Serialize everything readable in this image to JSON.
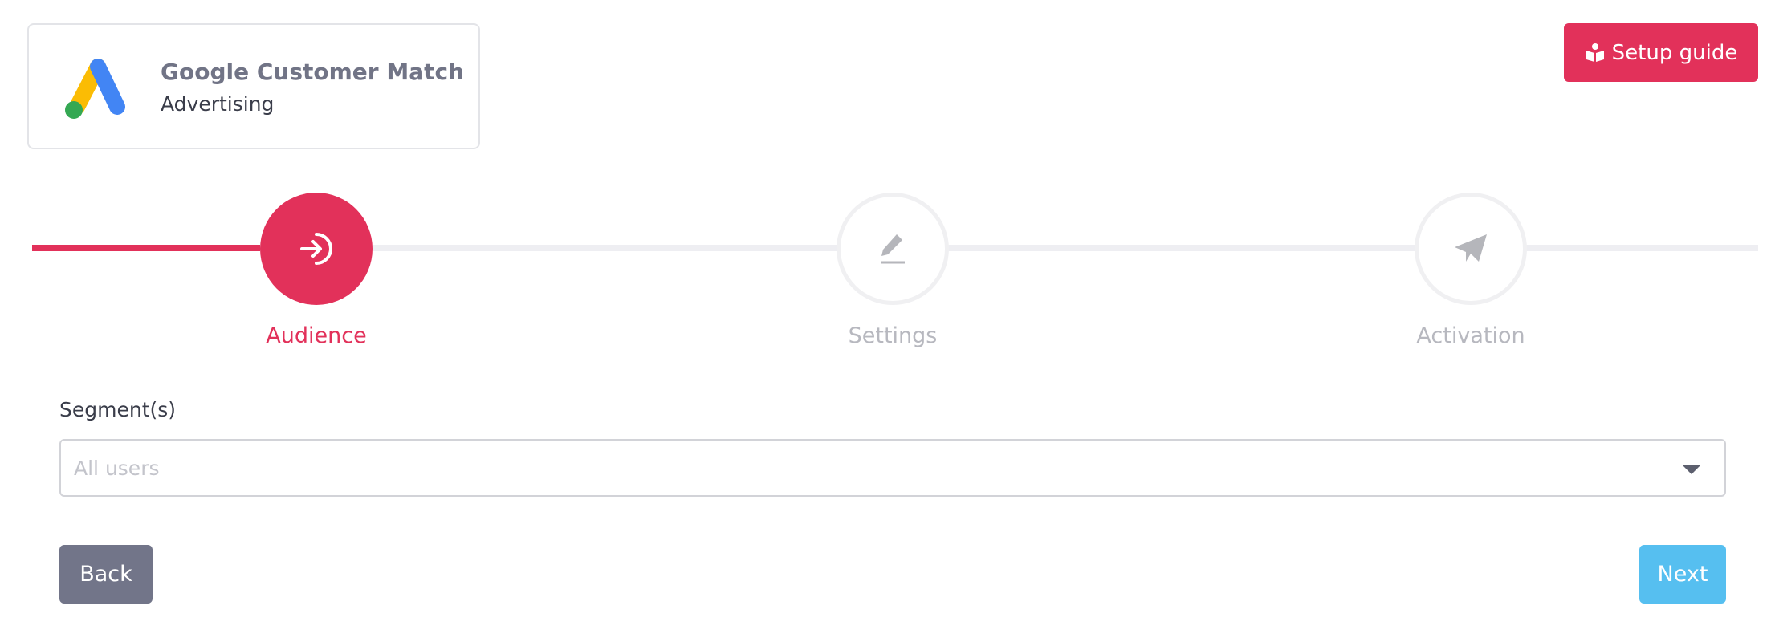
{
  "integration": {
    "name": "Google Customer Match",
    "category": "Advertising",
    "logo_icon": "google-ads-logo"
  },
  "header": {
    "setup_guide_label": "Setup guide",
    "setup_guide_icon": "book-reader-icon"
  },
  "stepper": {
    "steps": [
      {
        "label": "Audience",
        "icon": "sign-in-icon",
        "active": true
      },
      {
        "label": "Settings",
        "icon": "pencil-icon",
        "active": false
      },
      {
        "label": "Activation",
        "icon": "paper-plane-icon",
        "active": false
      }
    ]
  },
  "form": {
    "segment_label": "Segment(s)",
    "segment_placeholder": "All users"
  },
  "actions": {
    "back_label": "Back",
    "next_label": "Next"
  },
  "colors": {
    "accent": "#e2315a",
    "next": "#56bff0",
    "back": "#727589"
  }
}
